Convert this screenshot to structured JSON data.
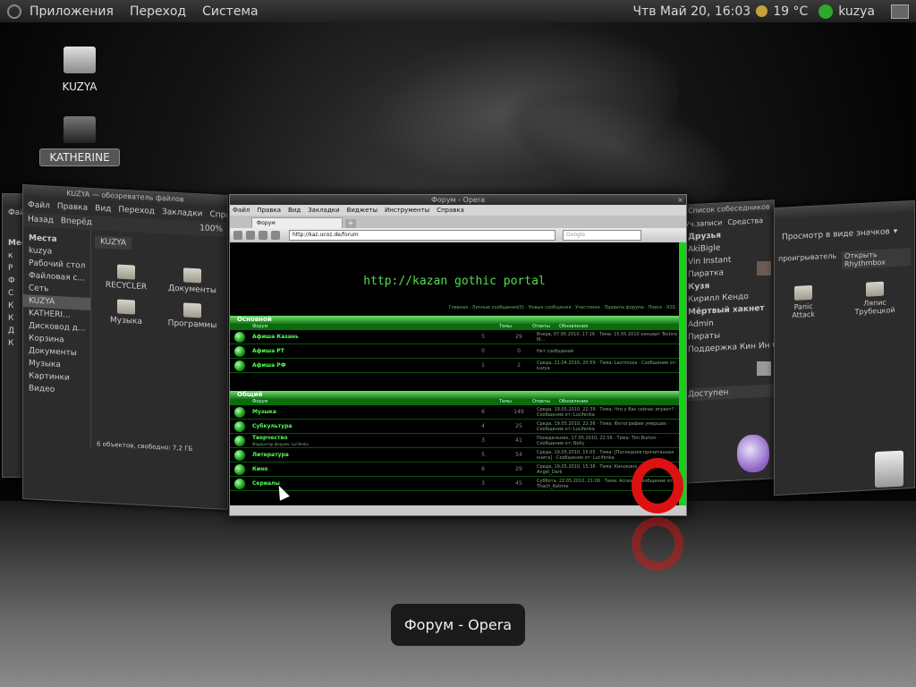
{
  "top_panel": {
    "menus": [
      "Приложения",
      "Переход",
      "Система"
    ],
    "datetime": "Чтв Май 20, 16:03",
    "temperature": "19 °C",
    "user": "kuzya"
  },
  "desktop_icons": [
    {
      "label": "KUZYA"
    },
    {
      "label": "KATHERINE"
    }
  ],
  "nautilus": {
    "title": "KUZYA — обозреватель файлов",
    "menu": [
      "Файл",
      "Правка",
      "Вид",
      "Переход",
      "Закладки",
      "Справка"
    ],
    "toolbar": {
      "back": "Назад",
      "forward": "Вперёд",
      "zoom": "100%"
    },
    "places_header": "Места",
    "location": "KUZYA",
    "places": [
      "kuzya",
      "Рабочий стол",
      "Файловая с...",
      "Сеть",
      "KUZYA",
      "KATHERI...",
      "Дисковод д...",
      "Корзина",
      "Документы",
      "Музыка",
      "Картинки",
      "Видео"
    ],
    "files": [
      "RECYCLER",
      "Документы",
      "Музыка",
      "Программы"
    ],
    "status": "6 объектов, свободно: 7,2 ГБ"
  },
  "left_back_window": {
    "menu": [
      "Файл",
      "Пр"
    ],
    "header": "Места",
    "items": [
      "к",
      "Р",
      "Ф",
      "С",
      "К",
      "К",
      "Д",
      "К",
      "Д",
      "М",
      "К",
      "В"
    ]
  },
  "opera": {
    "title": "Форум - Opera",
    "menu": [
      "Файл",
      "Правка",
      "Вид",
      "Закладки",
      "Виджеты",
      "Инструменты",
      "Справка"
    ],
    "tab_label": "Форум",
    "address": "http://kaz.ucoz.de/forum",
    "search_placeholder": "Google",
    "portal_title": "http://kazan gothic portal",
    "forum_links": "Главная · Личные сообщения(0) · Новые сообщения · Участники · Правила форума · Поиск · RSS",
    "columns": {
      "forum": "Форум",
      "topics": "Темы",
      "replies": "Ответы",
      "last": "Обновления"
    },
    "sections": [
      {
        "name": "Основной",
        "forums": [
          {
            "name": "Афиша Казань",
            "topics": "5",
            "replies": "29",
            "last": "Вчера, 07.05.2010, 17:16 · Тема: 15.05.2010 концерт Techno M..."
          },
          {
            "name": "Афиша РТ",
            "topics": "0",
            "replies": "0",
            "last": "Нет сообщений"
          },
          {
            "name": "Афиша РФ",
            "topics": "1",
            "replies": "2",
            "last": "Среда, 21.04.2010, 20:59 · Тема: Lacrimosa · Сообщение от: kuzya"
          }
        ]
      },
      {
        "name": "Общий",
        "forums": [
          {
            "name": "Музыка",
            "topics": "6",
            "replies": "149",
            "last": "Среда, 19.05.2010, 22:39 · Тема: Что у Вас сейчас играет? · Сообщение от: Lucifenka"
          },
          {
            "name": "Субкультура",
            "topics": "4",
            "replies": "25",
            "last": "Среда, 19.05.2010, 22:36 · Тема: Фотографии умерших · Сообщение от: Lucifenka"
          },
          {
            "name": "Творчество",
            "subtitle": "Модератор форума: Lucifenka",
            "topics": "3",
            "replies": "41",
            "last": "Понедельник, 17.05.2010, 22:56 · Тема: Tim Burton · Сообщение от: Nelly"
          },
          {
            "name": "Литература",
            "topics": "5",
            "replies": "54",
            "last": "Среда, 19.05.2010, 15:05 · Тема: [Последняя прочитанная книга] · Сообщение от: Lucifenka"
          },
          {
            "name": "Кино",
            "topics": "6",
            "replies": "29",
            "last": "Среда, 19.05.2010, 15:38 · Тема: Кинокино · Сообщение от: Angel_Dark"
          },
          {
            "name": "Сериалы",
            "topics": "3",
            "replies": "45",
            "last": "Суббота, 22.05.2010, 21:06 · Тема: Access · Сообщение от: Thach_Katrine"
          }
        ]
      }
    ]
  },
  "pidgin": {
    "title": "Список собеседников",
    "menu": [
      "Уч.записи",
      "Средства",
      "По"
    ],
    "groups": [
      "Друзья",
      "Мёртвый хакнет"
    ],
    "contacts": [
      "AkiBigle",
      "Vin Instant",
      "Пиратка",
      "Кузя",
      "Кирилл Кендо",
      "Admin",
      "Пираты",
      "Поддержка Кин Ин Син"
    ],
    "status": "Доступен"
  },
  "rhythmbox": {
    "view_mode": "Просмотр в виде значков",
    "player_label": "проигрыватель",
    "open_button": "Открыть Rhythmbox",
    "albums": [
      "Panic Attack",
      "Ляпис Трубецкой"
    ]
  },
  "caption": "Форум - Opera",
  "colors": {
    "accent_green": "#2bd02b",
    "opera_red": "#d11111",
    "panel": "#2a2a2a"
  }
}
